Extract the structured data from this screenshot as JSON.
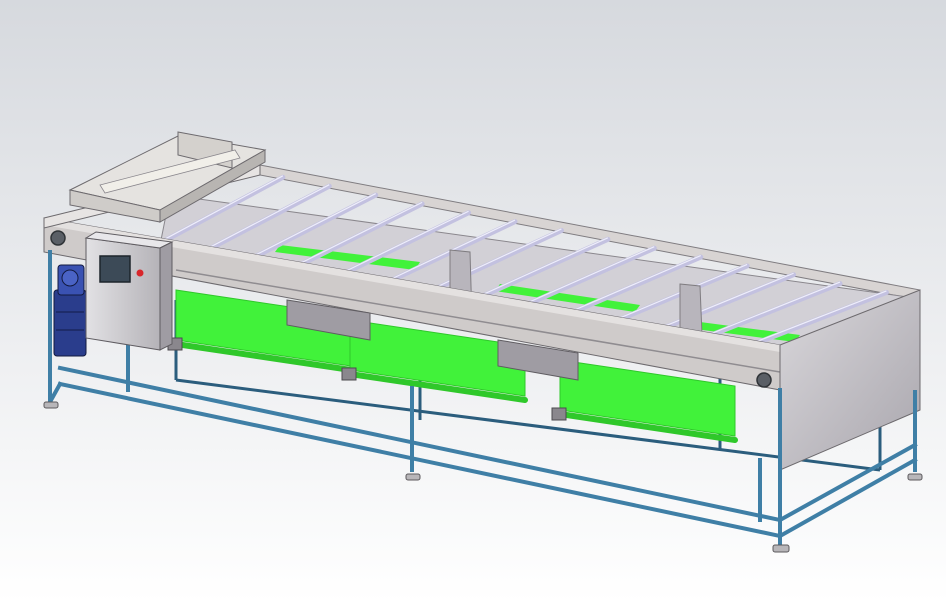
{
  "colors": {
    "background_top": "#d6d9de",
    "background_bottom": "#ffffff",
    "frame_steel": "#3f7fa6",
    "frame_steel_dark": "#2b5d7d",
    "belt_green": "#41f23a",
    "belt_green_dark": "#2fc82a",
    "panel_grey": "#c9c7cc",
    "panel_grey_dark": "#a9a6ad",
    "rail_grey": "#d8d4d3",
    "roller": "#c3c1e0",
    "motor_blue": "#2a3d8c",
    "screen_dark": "#3c4a57",
    "indicator_red": "#d8262b"
  },
  "parts": {
    "control_box": {
      "icon": "control-cabinet-icon"
    },
    "motor": {
      "icon": "gear-motor-icon"
    },
    "hopper": {
      "icon": "feed-hopper-icon"
    },
    "sorting_rollers": {
      "count": 14
    },
    "belt_conveyors": {
      "count": 3
    }
  }
}
